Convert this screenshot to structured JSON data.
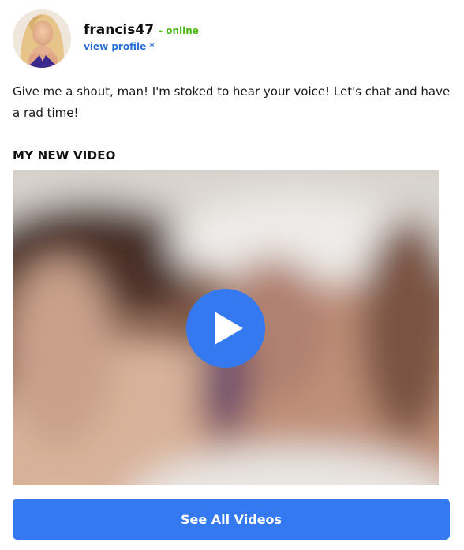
{
  "profile": {
    "username": "francis47",
    "status": "- online",
    "view_profile_label": "view profile *"
  },
  "bio": "Give me a shout, man! I'm stoked to hear your voice! Let's chat and have a rad time!",
  "video_section": {
    "title": "MY NEW VIDEO",
    "play_icon": "play-icon"
  },
  "cta": {
    "label": "See All Videos"
  },
  "colors": {
    "online_green": "#4cbb17",
    "link_blue": "#2a6fd6",
    "accent_blue": "#3479f0",
    "text": "#111111"
  }
}
